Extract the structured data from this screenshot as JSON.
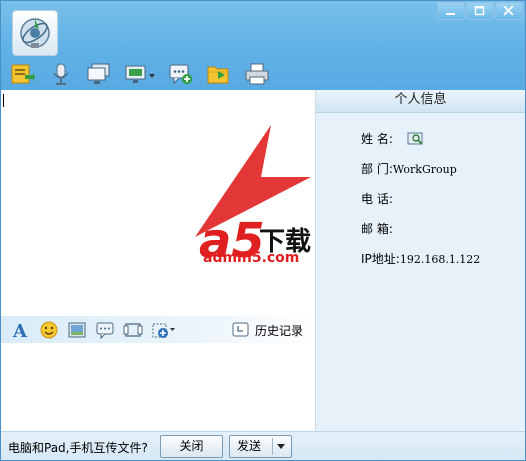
{
  "window": {
    "controls": [
      "minimize-icon",
      "maximize-icon",
      "close-icon"
    ]
  },
  "toolbar": {
    "icons": [
      "send-file-icon",
      "voice-microphone-icon",
      "remote-screen-icon",
      "video-screen-dropdown-icon",
      "add-message-icon",
      "folder-share-icon",
      "print-icon"
    ]
  },
  "watermark": {
    "text_main": "a5下载",
    "text_sub": "admin5.com"
  },
  "format_bar": {
    "icons": [
      "font-icon",
      "emoji-icon",
      "image-icon",
      "message-bubble-icon",
      "screenshot-icon",
      "add-dropdown-icon"
    ],
    "history_label": "历史记录"
  },
  "profile": {
    "title": "个人信息",
    "name_label": "姓 名:",
    "dept_label": "部 门:",
    "dept_value": "WorkGroup",
    "phone_label": "电 话:",
    "email_label": "邮 箱:",
    "ip_label": "IP地址:",
    "ip_value": "192.168.1.122"
  },
  "bottom_bar": {
    "prompt": "电脑和Pad,手机互传文件?",
    "close_label": "关闭",
    "send_label": "发送"
  },
  "colors": {
    "titlebar": "#5fb1e6",
    "panel_bg": "#e6f1fa",
    "logo_red": "#e02020"
  }
}
